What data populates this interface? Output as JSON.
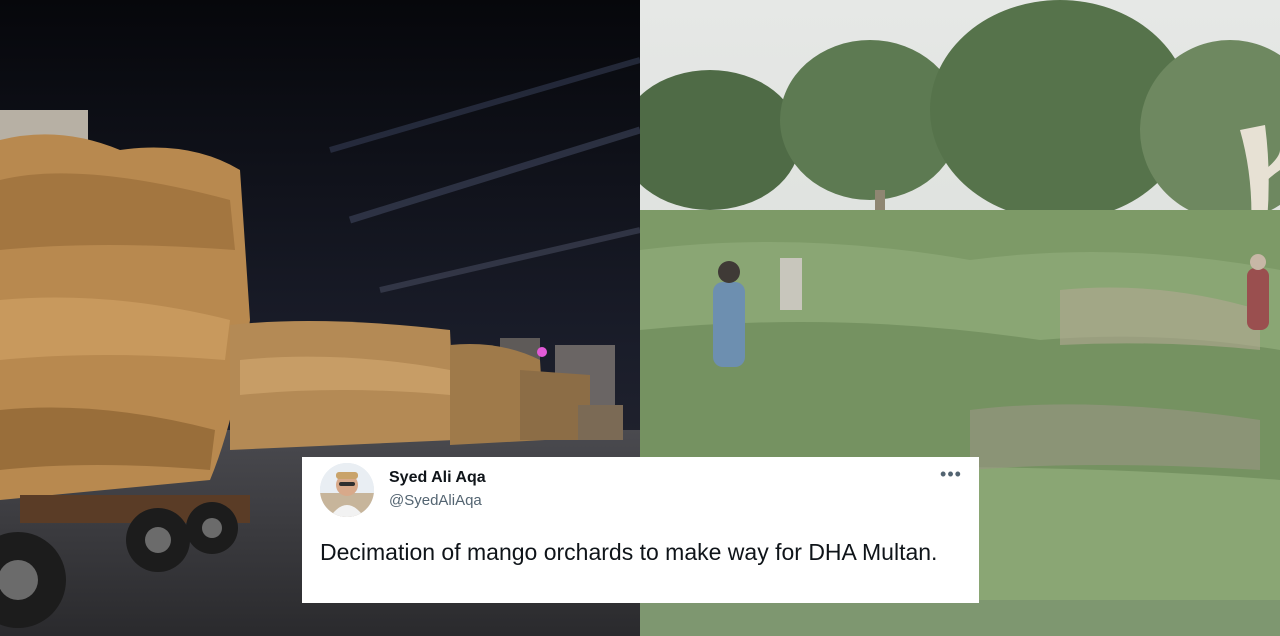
{
  "tweet": {
    "display_name": "Syed Ali Aqa",
    "handle": "@SyedAliAqa",
    "text": "Decimation of mango orchards to make way for DHA Multan.",
    "more_icon": "more-horizontal-icon"
  },
  "colors": {
    "card_background": "#ffffff",
    "name_text": "#0f1419",
    "handle_text": "#536471"
  }
}
